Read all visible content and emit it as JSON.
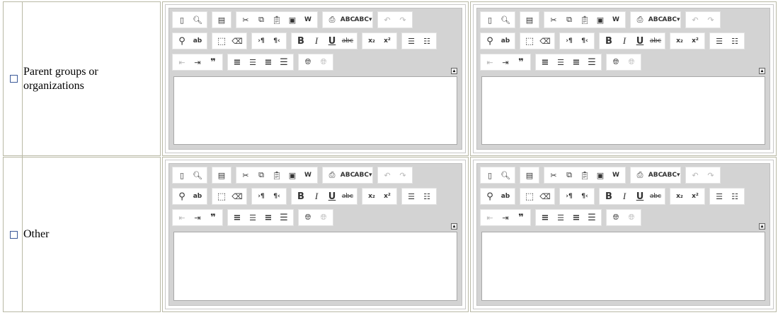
{
  "rows": [
    {
      "label": "Parent groups or organizations"
    },
    {
      "label": "Other"
    }
  ],
  "toolbar": {
    "row1": [
      [
        "new-page-icon",
        "preview-icon"
      ],
      [
        "templates-icon"
      ],
      [
        "cut-icon",
        "copy-icon",
        "paste-icon",
        "paste-text-icon",
        "paste-word-icon"
      ],
      [
        "print-icon",
        "spellcheck-icon",
        "spellcheck-as-you-type-icon"
      ],
      [
        "undo-icon",
        "redo-icon"
      ]
    ],
    "row2": [
      [
        "find-icon",
        "replace-icon"
      ],
      [
        "select-all-icon",
        "remove-format-icon"
      ],
      [
        "ltr-icon",
        "rtl-icon"
      ],
      [
        "bold-icon",
        "italic-icon",
        "underline-icon",
        "strikethrough-icon"
      ],
      [
        "subscript-icon",
        "superscript-icon"
      ],
      [
        "numbered-list-icon",
        "bulleted-list-icon"
      ]
    ],
    "row3": [
      [
        "outdent-icon",
        "indent-icon",
        "blockquote-icon"
      ],
      [
        "align-left-icon",
        "align-center-icon",
        "align-right-icon",
        "justify-icon"
      ],
      [
        "link-icon",
        "unlink-icon"
      ]
    ],
    "glyphs": {
      "bold": "B",
      "italic": "I",
      "underline": "U",
      "strike": "abc",
      "sub": "x₂",
      "sup": "x²",
      "abc": "ABC",
      "quote": "❞",
      "pilcrow_ltr": "›¶",
      "pilcrow_rtl": "¶‹",
      "collapse": "▲"
    }
  }
}
